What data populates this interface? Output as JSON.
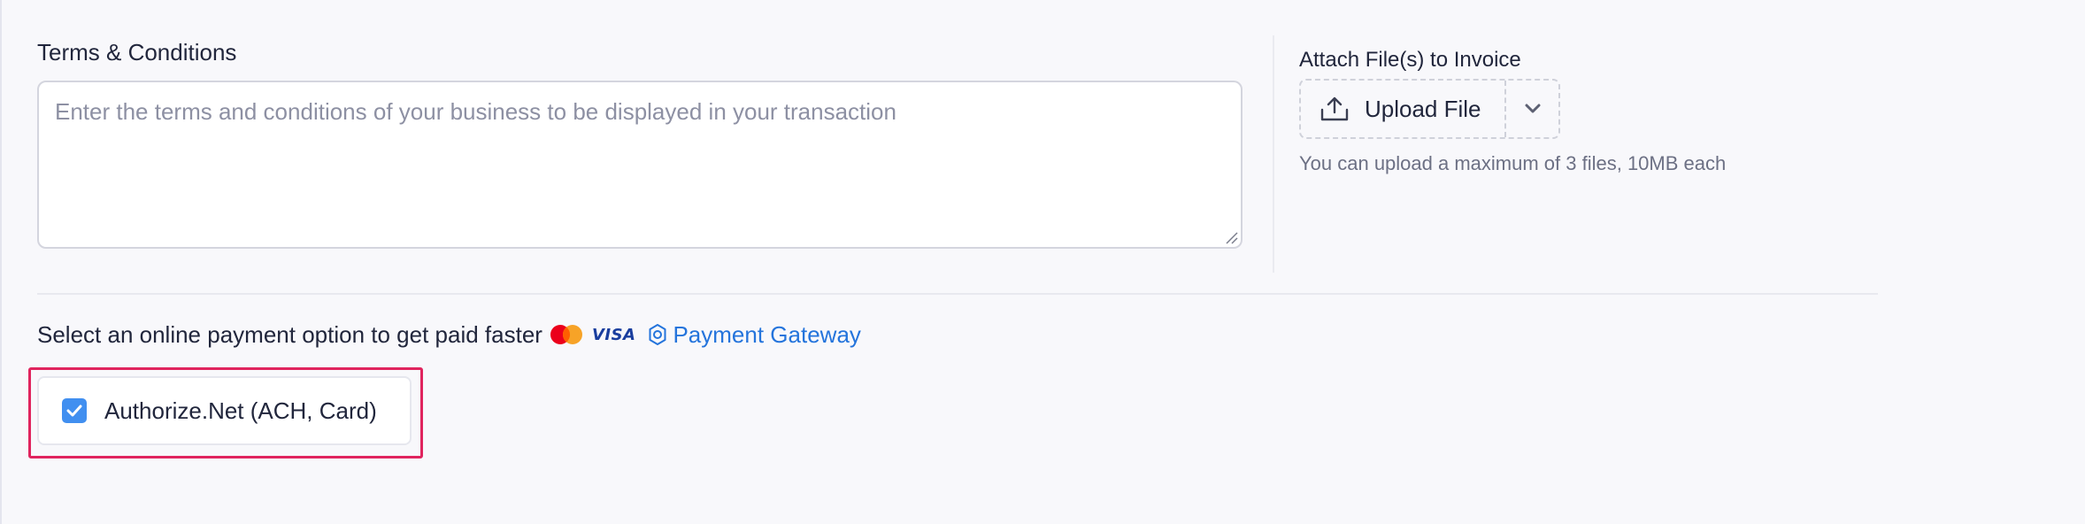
{
  "terms": {
    "label": "Terms & Conditions",
    "placeholder": "Enter the terms and conditions of your business to be displayed in your transaction",
    "value": ""
  },
  "attachments": {
    "label": "Attach File(s) to Invoice",
    "upload_button": "Upload File",
    "hint": "You can upload a maximum of 3 files, 10MB each"
  },
  "payment": {
    "prompt": "Select an online payment option to get paid faster",
    "card_logos": [
      "mastercard",
      "VISA"
    ],
    "gateway_link": "Payment Gateway",
    "options": [
      {
        "label": "Authorize.Net (ACH, Card)",
        "checked": true
      }
    ]
  },
  "colors": {
    "link": "#2474dc",
    "checkbox": "#418ff0",
    "highlight": "#e0245e"
  }
}
